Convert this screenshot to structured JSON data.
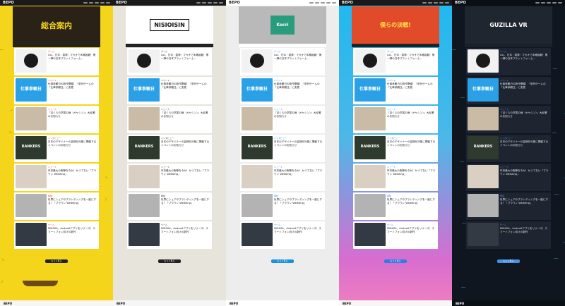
{
  "panels": [
    {
      "id": "p1",
      "theme": "yellow",
      "logo": "BEPO",
      "hero_text": "総合案内",
      "hero_caption": "",
      "colors": {
        "bg": "#f4d51c",
        "card": "#ffffff",
        "text": "#222222",
        "accent": "#e23a2c",
        "bar": "#1a1a1a"
      },
      "more_label": "もっと見る",
      "footer_logo": "BEPO"
    },
    {
      "id": "p2",
      "theme": "manga",
      "logo": "BEPO",
      "hero_text": "NISIOISIN",
      "hero_caption": "",
      "colors": {
        "bg": "#e7e4db",
        "card": "#ffffff",
        "text": "#222222",
        "accent": "#333333",
        "bar": "#1a1a1a"
      },
      "more_label": "もっと見る",
      "footer_logo": "BEPO"
    },
    {
      "id": "p3",
      "theme": "gray",
      "logo": "BEPO",
      "hero_text": "Kocri",
      "hero_caption": "",
      "colors": {
        "bg": "#ededed",
        "card": "#ffffff",
        "text": "#222222",
        "accent": "#1b8fe0",
        "bar": "#ffffff"
      },
      "more_label": "もっと見る",
      "footer_logo": "BEPO"
    },
    {
      "id": "p4",
      "theme": "game",
      "logo": "BEPO",
      "hero_text": "僕らの決戦!",
      "hero_caption": "",
      "colors": {
        "bg": "#1fb8f0",
        "card": "#ffffff",
        "text": "#222222",
        "accent": "#2f7de0",
        "bar": "#1a1a1a"
      },
      "more_label": "もっと見る",
      "footer_logo": "BEPO"
    },
    {
      "id": "p5",
      "theme": "dark",
      "logo": "BEPO",
      "hero_text": "GUZILLA VR",
      "hero_caption": "",
      "colors": {
        "bg": "#0f1620",
        "card": "#1e2430",
        "text": "#e6e6e6",
        "accent": "#4a90e2",
        "bar": "#0a0f16"
      },
      "more_label": "もっと見る",
      "footer_logo": "BEPO"
    }
  ],
  "cards": [
    {
      "tag": "ゲーム",
      "title": "LoL、日本・香港・マカオで本格始動！第一弾の日本プラットフォーム…",
      "thumb": "mascot",
      "thumb_text": ""
    },
    {
      "tag": "イベント",
      "title": "仕事参観日の新作開催！「前列ゲームの「仕事参観日」に変更",
      "thumb": "blue",
      "thumb_text": "仕事参観日"
    },
    {
      "tag": "ニュース",
      "title": "「ぼくらの学習の扉（オヤシン）」大反響のお知らせ",
      "thumb": "photo",
      "thumb_text": ""
    },
    {
      "tag": "インタビュー",
      "title": "日本のデザイナーの皆様を対象に開催するイベントのお知らせ",
      "thumb": "green",
      "thumb_text": "RANKERS"
    },
    {
      "tag": "ニュース",
      "title": "年末最大の衝撃を今か！かつてない「ブラウン Wedding」",
      "thumb": "photo2",
      "thumb_text": ""
    },
    {
      "tag": "特集",
      "title": "世界にシェアのブランディングを一度にする！「ブラウン Wedding」",
      "thumb": "gray",
      "thumb_text": ""
    },
    {
      "tag": "ゲーム",
      "title": "MIKASA、Androidアプリをリリース！スマートフォン向けの新作",
      "thumb": "dark",
      "thumb_text": ""
    }
  ]
}
